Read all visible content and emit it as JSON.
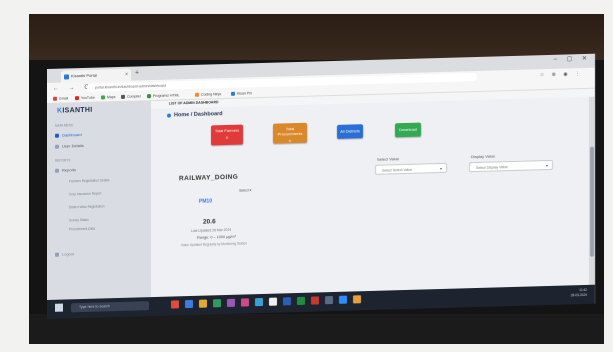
{
  "browser": {
    "tab_title": "Kisanthi Portal",
    "new_tab": "+",
    "window_controls": "– ▢ ✕",
    "nav_buttons": "← → C",
    "url": "portal.kisanthi.in/dashboard-admin/dashboard",
    "extensions": "☆ ⊕ ◉ ⋮",
    "bookmarks": [
      "Gmail",
      "YouTube",
      "Maps",
      "Compiler",
      "Programiz HTML",
      "Coding Ninja",
      "Kisan Pm"
    ]
  },
  "app": {
    "logo_prefix": "K",
    "logo_rest": "ISANTHI",
    "top_title": "LIST OF ADMIN DASHBOARD",
    "sidebar": {
      "heading_main": "MAIN MENU",
      "items": [
        {
          "label": "Dashboard"
        },
        {
          "label": "User Details"
        }
      ],
      "heading_reports": "REPORTS",
      "reports_item": "Reports",
      "sub_items": [
        "Farmers Registration Details",
        "Crop Insurance Report",
        "District Wise Registration",
        "Survey Status",
        "Procurement Data"
      ],
      "footer_item": "Logout"
    },
    "breadcrumb": "Home / Dashboard",
    "cards": [
      {
        "label": "Total Farmers",
        "value": "0",
        "color": "#e03a3a"
      },
      {
        "label": "Total Procurements",
        "value": "0",
        "color": "#d9882a"
      },
      {
        "label": "All Districts",
        "value": "",
        "color": "#2a6fd6"
      },
      {
        "label": "Download",
        "value": "",
        "color": "#34a853"
      }
    ],
    "section_title": "RAILWAY_DOING",
    "filters": [
      {
        "label": "Select Value",
        "placeholder": "Select Select Value"
      },
      {
        "label": "Display Value",
        "placeholder": "Select Display Value"
      }
    ],
    "metric_select": "Select ▾",
    "metric_name": "PM10",
    "metric_value": "20.6",
    "info_line1": "Last Updated 28 Mar 2024",
    "info_line2": "Range: 0 – 1000 μg/m³",
    "info_line3": "Value Updated Regularly by Monitoring Station"
  },
  "taskbar": {
    "search_placeholder": "Type here to search",
    "tray_time": "11:42",
    "tray_date": "28-03-2024"
  }
}
